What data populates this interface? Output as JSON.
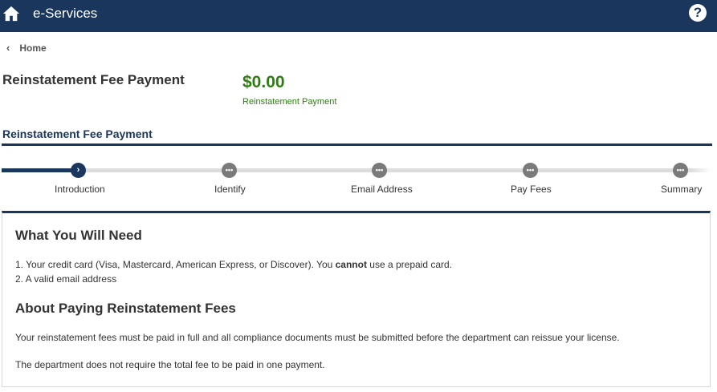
{
  "header": {
    "app_title": "e-Services",
    "help_glyph": "?"
  },
  "breadcrumb": {
    "chevron": "‹",
    "home_label": "Home"
  },
  "page": {
    "title": "Reinstatement Fee Payment",
    "amount": "$0.00",
    "amount_label": "Reinstatement Payment",
    "section_title": "Reinstatement Fee Payment"
  },
  "stepper": {
    "steps": [
      {
        "label": "Introduction",
        "icon": "chevron-right-icon",
        "glyph": "›",
        "status": "current"
      },
      {
        "label": "Identify",
        "icon": "ellipsis-icon",
        "glyph": "•••",
        "status": "pending"
      },
      {
        "label": "Email Address",
        "icon": "ellipsis-icon",
        "glyph": "•••",
        "status": "pending"
      },
      {
        "label": "Pay Fees",
        "icon": "ellipsis-icon",
        "glyph": "•••",
        "status": "pending"
      },
      {
        "label": "Summary",
        "icon": "ellipsis-icon",
        "glyph": "•••",
        "status": "pending"
      }
    ]
  },
  "content": {
    "need_heading": "What You Will Need",
    "need_item1_pre": "1. Your credit card (Visa, Mastercard, American Express, or Discover). You ",
    "need_item1_bold": "cannot",
    "need_item1_post": " use a prepaid card.",
    "need_item2": "2. A valid email address",
    "about_heading": "About Paying Reinstatement Fees",
    "about_p1": "Your reinstatement fees must be paid in full and all compliance documents must be submitted before the department can reissue your license.",
    "about_p2": "The department does not require the total fee to be paid in one payment."
  },
  "colors": {
    "navy": "#1a365d",
    "green": "#2e7d12",
    "pending_dot": "#7a7a7a"
  }
}
